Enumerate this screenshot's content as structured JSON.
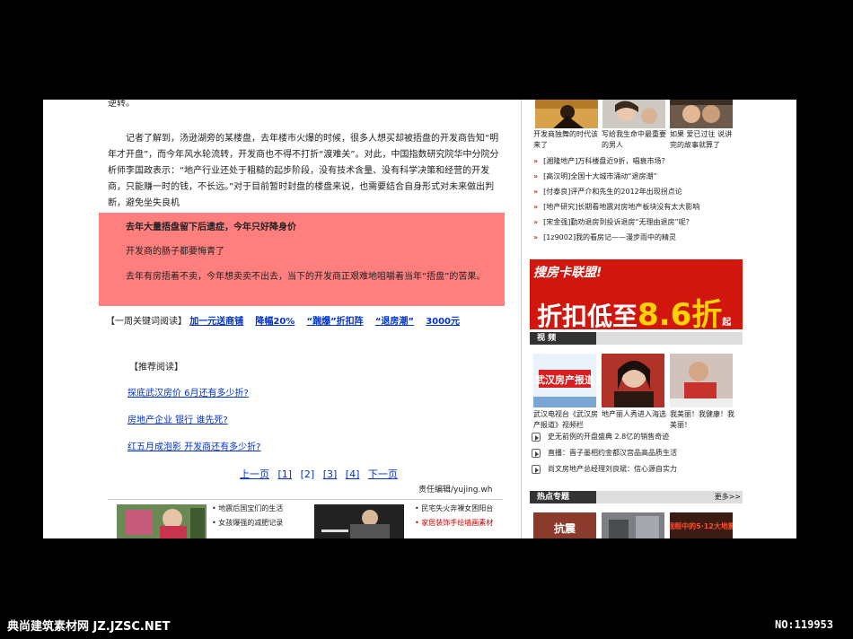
{
  "article": {
    "top_line": "逆转。",
    "para2": "记者了解到，汤逊湖旁的某楼盘，去年楼市火爆的时候，很多人想买却被捂盘的开发商告知“明年才开盘”，而今年风水轮流转，开发商也不得不打折“渡难关”。对此，中国指数研究院华中分院分析师李国政表示：“地产行业还处于粗糙的起步阶段，没有技术含量、没有科学决策和经营的开发商，只能赚一时的钱，不长远。”对于目前暂时封盘的楼盘来说，也需要结合自身形式对未来做出判断，避免坐失良机",
    "highlight_title": "去年大量捂盘留下后遗症，今年只好降身价",
    "highlight_line2": "开发商的肠子都要悔青了",
    "highlight_line3": "去年有房捂着不卖，今年想卖卖不出去，当下的开发商正艰难地咀嚼着当年“捂盘”的苦果。",
    "keyword_prefix": "【一周关键词阅读】",
    "keywords": [
      "加一元送商铺",
      "降幅20%",
      "“踹爆”折扣阵",
      "“退房潮”",
      "3000元"
    ],
    "recommend_title": "【推荐阅读】",
    "recommends": [
      "探底武汉房价 6月还有多少折?",
      "房地产企业 银行 谁先死?",
      "红五月成泡影 开发商还有多少折?"
    ],
    "pager": {
      "prev": "上一页",
      "p1": "[1]",
      "p2": "[2]",
      "p3": "[3]",
      "p4": "[4]",
      "next": "下一页"
    },
    "editor": "责任编辑/yujing.wh"
  },
  "bottom_links": {
    "a1": "• 地震后国宝们的生活",
    "a2": "• 女孩爆强的减肥记录",
    "b1": "• 民宅失火奔裸女困阳台",
    "b2": "• 家居装饰手绘墙画素材"
  },
  "sidebar": {
    "top_captions": [
      "开发商独舞的时代该来了",
      "写给我生命中最重要的男人",
      "如果 爱已过往 说讲完的故事就算了"
    ],
    "news": [
      "[湘隆地产]万科楼盘近9折，唱衰市场？",
      "[高汉明]全国十大城市涌动“退房潮”",
      "[付泰良]评严介和先生的2012年出现拐点论",
      "[地产研究]长期看地震对房地产板块没有太大影响",
      "[宋金强]勤劝退房到投诉退房“无理由退房”呢？",
      "[1z9002]我的看房记——漫步雨中的精灵"
    ],
    "ad": {
      "logo": "搜房卡联盟!",
      "text_prefix": "折扣低至",
      "text_value": "8.6折",
      "text_suffix": "起"
    },
    "video_section": "视 频",
    "video_captions": [
      "武汉电视台《武汉房产报道》视频栏",
      "地产丽人秀进入海选",
      "我美丽！我健康！我美丽！"
    ],
    "video_tag": "武汉房产报道",
    "video_lines": [
      "史无前例的开盘盛典 2.8亿的销售奇迹",
      "直播：晋子墨相约金都汉宫品高品质生活",
      "尚文房地产总经理刘良斌：信心源自实力"
    ],
    "hot_section": "热点专题",
    "hot_more": "更多>>",
    "hot_labels": [
      "抗震",
      "",
      "我眼中的5·12大地震"
    ]
  },
  "watermark": {
    "left": "典尚建筑素材网 JZ.JZSC.NET",
    "right": "NO:119953"
  },
  "colors": {
    "highlight": "#ff7f7f",
    "link": "#0033cc",
    "ad_red": "#d1160e"
  }
}
